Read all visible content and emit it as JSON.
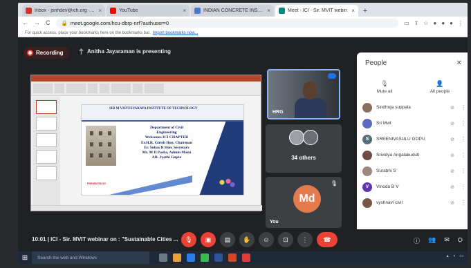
{
  "browser": {
    "tabs": [
      {
        "label": "Inbox - jsnhdev@ich.org · INDIA",
        "color": "#d93025",
        "active": false
      },
      {
        "label": "YouTube",
        "color": "#ff0000",
        "active": false
      },
      {
        "label": "INDIAN CONCRETE INSTITUTE",
        "color": "#4a7bd1",
        "active": false
      },
      {
        "label": "Meet - ICI - Sir. MVIT webin",
        "color": "#00897b",
        "active": true
      }
    ],
    "new_tab": "+",
    "address": "meet.google.com/hcu-dbrp-nrf?authuser=0",
    "bookmarks_text": "For quick access, place your bookmarks here on the bookmarks bar.",
    "bookmarks_link": "Import bookmarks now..."
  },
  "meet": {
    "recording_label": "Recording",
    "presenting_text": "Anitha Jayaraman is presenting",
    "slide": {
      "institute": "SIR M VISVESVARAYA INSTITUTE OF TECHNOLOGY",
      "lines": [
        "Department  of  Civil",
        "Engineering",
        "Welcomes ICI CHAPTER",
        "Er.H.R. Girish Hon. Chairman",
        "Er. Suhas R Hon. Secretary",
        "Mr. M D Pasha, Admin Mana",
        "AR. Jyothi Gupta"
      ],
      "presented_by": "PRESENTED BY"
    },
    "tiles": {
      "presenter_label": "HRG",
      "others_label": "34 others",
      "you_initials": "Md",
      "you_label": "You"
    },
    "meeting_info": "10:01  |  ICI - Sir. MVIT webinar on : \"Sustainable Cities ..."
  },
  "people": {
    "title": "People",
    "mute_all": "Mute all",
    "all_people": "All people",
    "participants": [
      {
        "name": "Sindhuja suppala",
        "initial": "",
        "color": "#8d6e63"
      },
      {
        "name": "Sri Mvit",
        "initial": "",
        "color": "#5c6bc0"
      },
      {
        "name": "SREENIVASULU GOPU",
        "initial": "S",
        "color": "#546e7a"
      },
      {
        "name": "Srividya Angalakuduti",
        "initial": "",
        "color": "#6d4c41"
      },
      {
        "name": "Surabhi S",
        "initial": "",
        "color": "#a1887f"
      },
      {
        "name": "Vinoda B V",
        "initial": "V",
        "color": "#5e35b1"
      },
      {
        "name": "vyshnavi civil",
        "initial": "",
        "color": "#795548"
      }
    ]
  },
  "taskbar": {
    "search_placeholder": "Search the web and Windows"
  }
}
